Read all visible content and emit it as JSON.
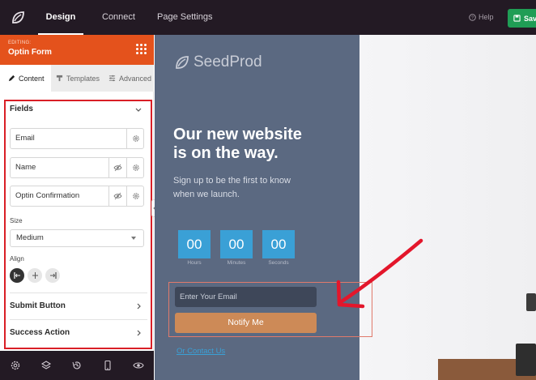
{
  "topbar": {
    "tabs": [
      "Design",
      "Connect",
      "Page Settings"
    ],
    "help_label": "Help",
    "save_label": "Save"
  },
  "sidebar": {
    "editing_label": "EDITING:",
    "block_title": "Optin Form",
    "tabs": [
      "Content",
      "Templates",
      "Advanced"
    ],
    "fields_heading": "Fields",
    "fields": [
      "Email",
      "Name",
      "Optin Confirmation"
    ],
    "size_label": "Size",
    "size_value": "Medium",
    "align_label": "Align",
    "sections": [
      "Submit Button",
      "Success Action"
    ]
  },
  "preview": {
    "brand": "SeedProd",
    "headline_line1": "Our new website",
    "headline_line2": "is on the way.",
    "subline_line1": "Sign up to be the first to know",
    "subline_line2": "when we launch.",
    "countdown": [
      {
        "value": "00",
        "label": "Hours"
      },
      {
        "value": "00",
        "label": "Minutes"
      },
      {
        "value": "00",
        "label": "Seconds"
      }
    ],
    "email_placeholder": "Enter Your Email",
    "button_label": "Notify Me",
    "contact_link": "Or Contact Us"
  },
  "colors": {
    "topbar": "#231a24",
    "accent_orange": "#e4521c",
    "highlight_red": "#d91f26",
    "hero_bg": "#5b6981",
    "countdown_blue": "#3aa0d6",
    "button_tan": "#cd8a57",
    "save_green": "#1f9d55"
  },
  "icons": [
    "seedprod-leaf-icon",
    "help-circle-icon",
    "save-icon",
    "grid-dots-icon",
    "pencil-icon",
    "templates-icon",
    "sliders-icon",
    "gear-icon",
    "eye-off-icon",
    "chevron-icon",
    "settings-icon",
    "layers-icon",
    "history-icon",
    "mobile-icon",
    "eye-icon"
  ]
}
